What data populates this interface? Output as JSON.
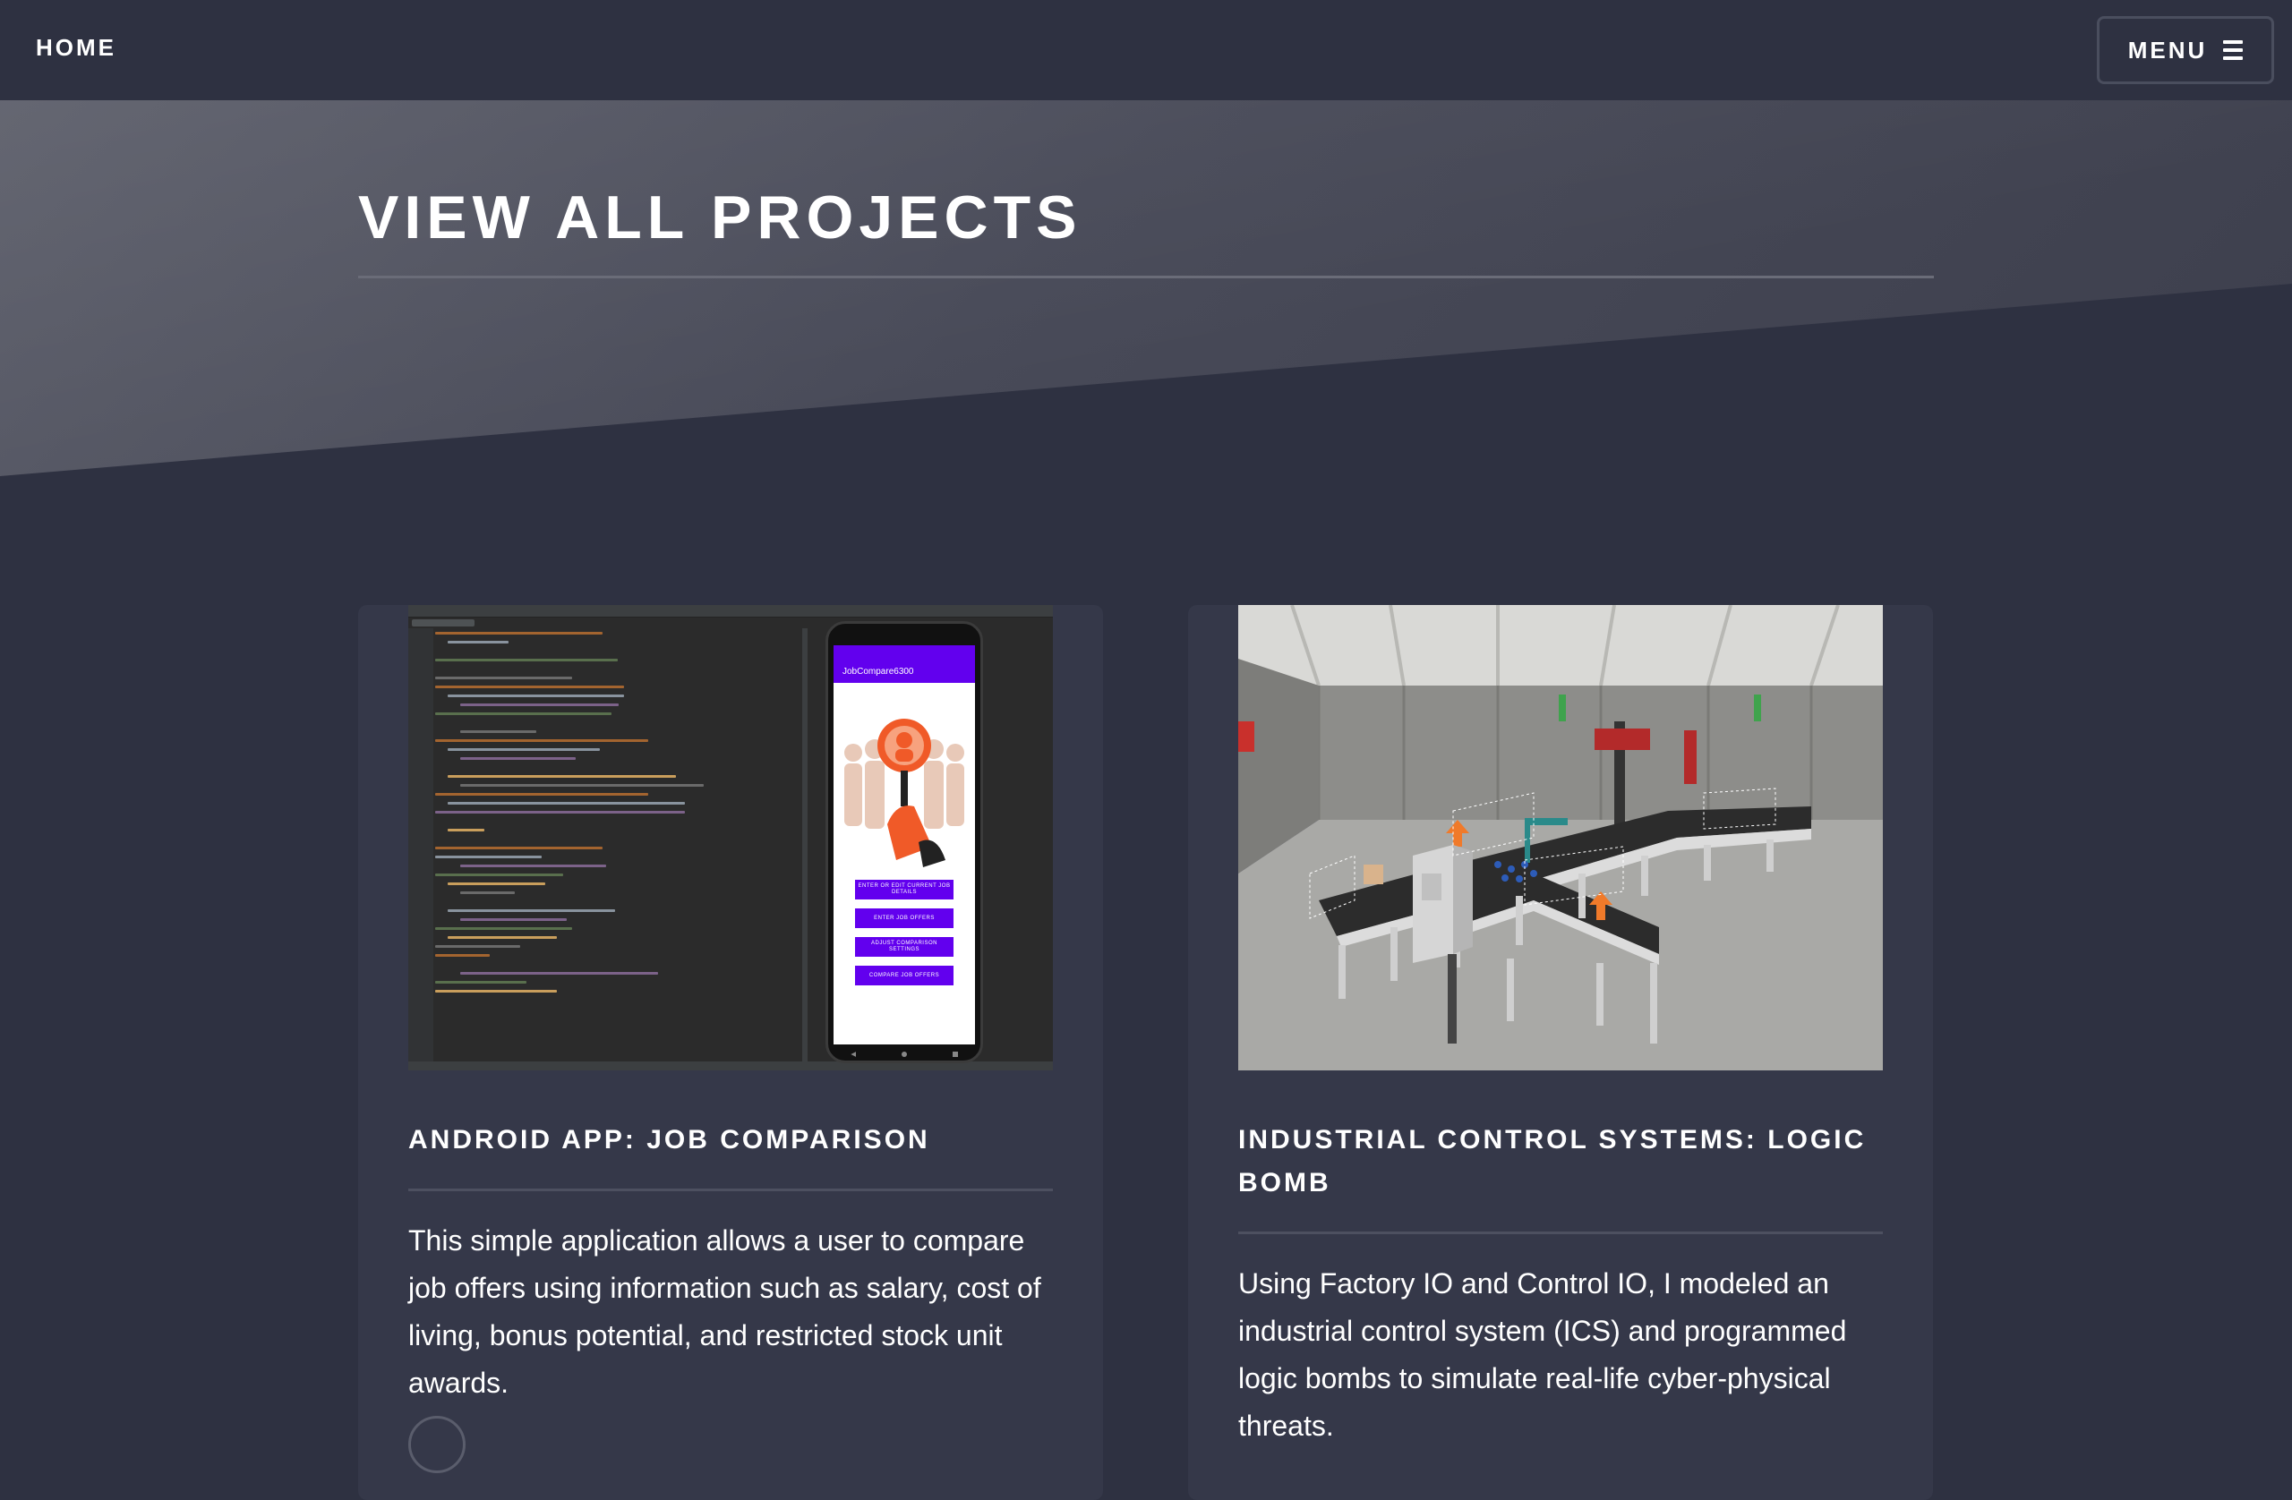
{
  "header": {
    "home_label": "HOME",
    "menu_label": "MENU"
  },
  "banner": {
    "title": "VIEW ALL PROJECTS"
  },
  "projects": [
    {
      "title": "ANDROID APP: JOB COMPARISON",
      "description": "This simple application allows a user to compare job offers using information such as salary, cost of living, bonus potential, and restricted stock unit awards.",
      "image_icon": "android-ide-screenshot",
      "phone": {
        "app_title": "JobCompare6300",
        "buttons": [
          "ENTER OR EDIT CURRENT JOB DETAILS",
          "ENTER JOB OFFERS",
          "ADJUST COMPARISON SETTINGS",
          "COMPARE JOB OFFERS"
        ]
      }
    },
    {
      "title": "INDUSTRIAL CONTROL SYSTEMS: LOGIC BOMB",
      "description": "Using Factory IO and Control IO, I modeled an industrial control system (ICS) and programmed logic bombs to simulate real-life cyber-physical threats.",
      "image_icon": "factory-conveyor-render"
    }
  ],
  "colors": {
    "background": "#2e3141",
    "card": "#353849",
    "accent_purple": "#6200ee",
    "accent_orange": "#f05a28"
  }
}
